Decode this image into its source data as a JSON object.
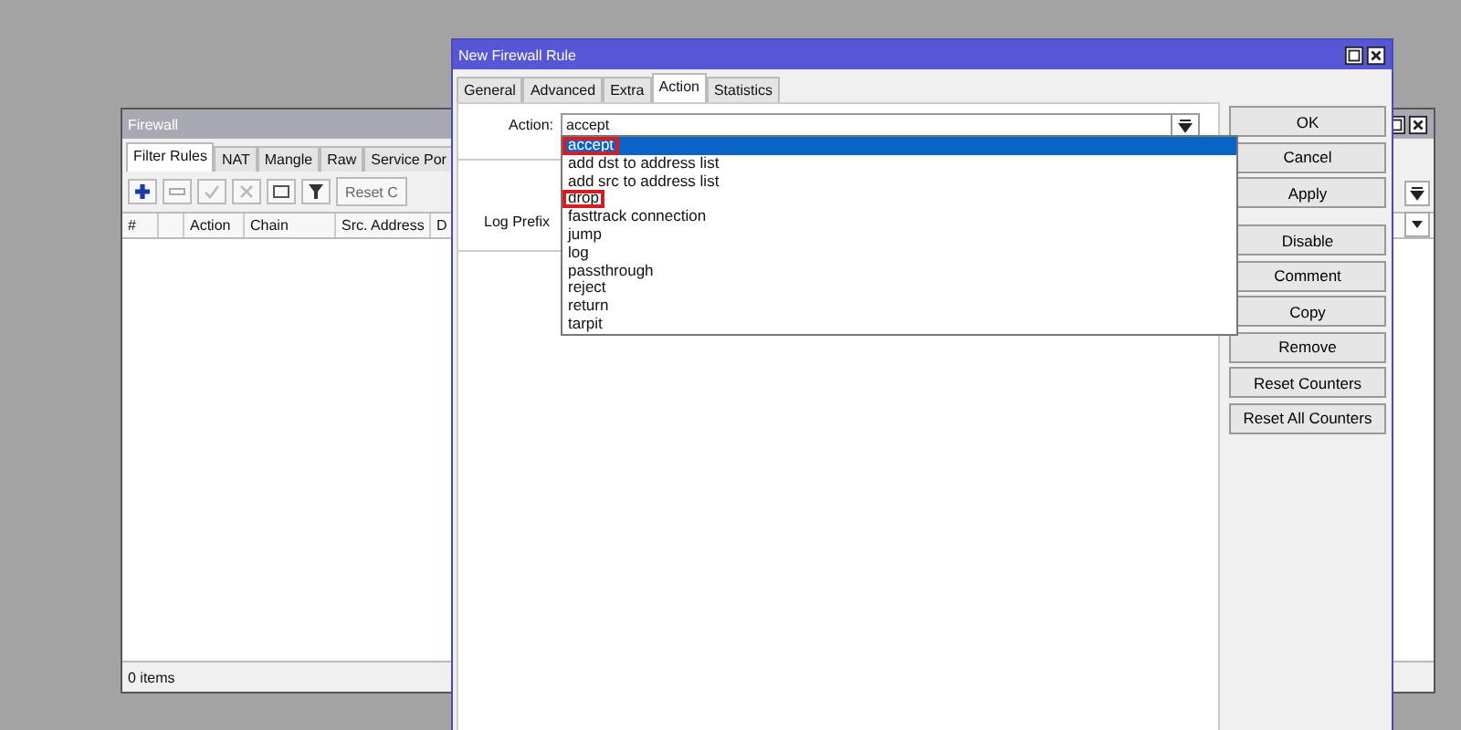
{
  "firewall_window": {
    "title": "Firewall",
    "tabs": [
      {
        "label": "Filter Rules",
        "selected": true
      },
      {
        "label": "NAT",
        "selected": false
      },
      {
        "label": "Mangle",
        "selected": false
      },
      {
        "label": "Raw",
        "selected": false
      },
      {
        "label": "Service Por",
        "selected": false
      }
    ],
    "reset_button": "Reset C",
    "columns": [
      {
        "label": "#"
      },
      {
        "kind": "blank"
      },
      {
        "label": "Action"
      },
      {
        "label": "Chain"
      },
      {
        "label": "Src. Address"
      },
      {
        "label": "D"
      }
    ],
    "status": "0 items"
  },
  "rule_dialog": {
    "title": "New Firewall Rule",
    "tabs": [
      {
        "label": "General",
        "selected": false
      },
      {
        "label": "Advanced",
        "selected": false
      },
      {
        "label": "Extra",
        "selected": false
      },
      {
        "label": "Action",
        "selected": true
      },
      {
        "label": "Statistics",
        "selected": false
      }
    ],
    "action_label": "Action:",
    "action_value": "accept",
    "log_prefix_label": "Log Prefix",
    "options": [
      {
        "label": "accept",
        "selected": true,
        "highlighted": true
      },
      {
        "label": "add dst to address list",
        "selected": false,
        "highlighted": false
      },
      {
        "label": "add src to address list",
        "selected": false,
        "highlighted": false
      },
      {
        "label": "drop",
        "selected": false,
        "highlighted": true
      },
      {
        "label": "fasttrack connection",
        "selected": false,
        "highlighted": false
      },
      {
        "label": "jump",
        "selected": false,
        "highlighted": false
      },
      {
        "label": "log",
        "selected": false,
        "highlighted": false
      },
      {
        "label": "passthrough",
        "selected": false,
        "highlighted": false
      },
      {
        "label": "reject",
        "selected": false,
        "highlighted": false
      },
      {
        "label": "return",
        "selected": false,
        "highlighted": false
      },
      {
        "label": "tarpit",
        "selected": false,
        "highlighted": false
      }
    ],
    "buttons": [
      "OK",
      "Cancel",
      "Apply"
    ],
    "rule_buttons": [
      "Disable",
      "Comment",
      "Copy",
      "Remove",
      "Reset Counters",
      "Reset All Counters"
    ]
  }
}
